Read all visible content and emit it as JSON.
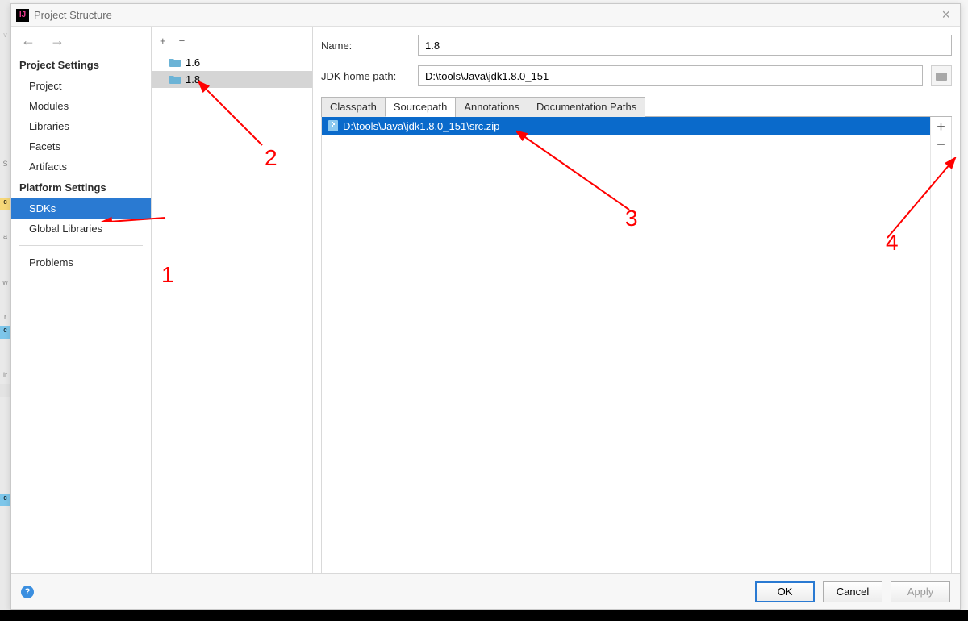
{
  "window": {
    "title": "Project Structure"
  },
  "sidebar": {
    "heading1": "Project Settings",
    "items1": [
      "Project",
      "Modules",
      "Libraries",
      "Facets",
      "Artifacts"
    ],
    "heading2": "Platform Settings",
    "items2": [
      "SDKs",
      "Global Libraries"
    ],
    "problems": "Problems",
    "selected": "SDKs"
  },
  "sdkList": {
    "items": [
      "1.6",
      "1.8"
    ],
    "selected": "1.8"
  },
  "main": {
    "nameLabel": "Name:",
    "nameValue": "1.8",
    "homeLabel": "JDK home path:",
    "homeValue": "D:\\tools\\Java\\jdk1.8.0_151",
    "tabs": [
      "Classpath",
      "Sourcepath",
      "Annotations",
      "Documentation Paths"
    ],
    "activeTab": "Sourcepath",
    "paths": [
      "D:\\tools\\Java\\jdk1.8.0_151\\src.zip"
    ]
  },
  "footer": {
    "ok": "OK",
    "cancel": "Cancel",
    "apply": "Apply"
  },
  "annotations": {
    "n1": "1",
    "n2": "2",
    "n3": "3",
    "n4": "4"
  }
}
